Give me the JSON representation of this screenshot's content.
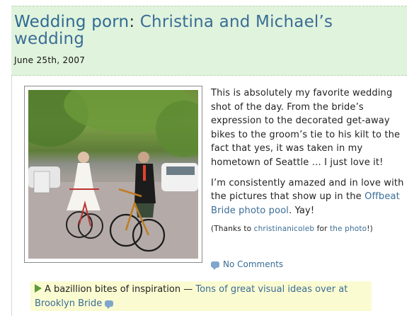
{
  "post": {
    "category": "Wedding porn",
    "separator": ":",
    "title_line1": "Christina and Michael’s",
    "title_line2": "wedding",
    "date": "June 25th, 2007"
  },
  "content": {
    "paragraph1": "This is absolutely my favorite wedding shot of the day. From the bride’s expression to the decorated get-away bikes to the groom’s tie to his kilt to the fact that yes, it was taken in my hometown of Seattle … I just love it!",
    "paragraph2_prefix": "I’m consistently amazed and in love with the pictures that show up in the ",
    "paragraph2_link": "Offbeat Bride photo pool",
    "paragraph2_suffix": ". Yay!",
    "thanks_prefix": "(Thanks to ",
    "thanks_user": "christinanicoleb",
    "thanks_mid": " for ",
    "thanks_link": "the photo",
    "thanks_suffix": "!)"
  },
  "comments": {
    "label": "No Comments",
    "icon": "comment-bubble-icon"
  },
  "related": {
    "icon": "arrow-right-icon",
    "prefix": "A bazillion bites of inspiration — ",
    "link": "Tons of great visual ideas over at Brooklyn Bride"
  },
  "colors": {
    "header_bg": "#e0f3dc",
    "link": "#3a6d96",
    "related_bg": "#fbfbd2",
    "arrow": "#5d9a3a"
  }
}
